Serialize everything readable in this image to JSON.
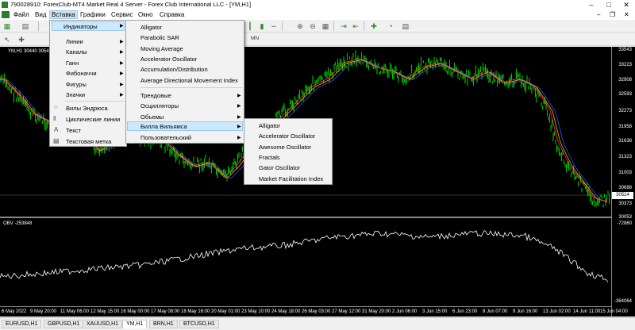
{
  "window": {
    "title": "790028910: ForexClub-MT4 Market Real 4 Server - Forex Club International LLC - [YM,H1]"
  },
  "menubar": {
    "items": [
      "Файл",
      "Вид",
      "Вставка",
      "Графики",
      "Сервис",
      "Окно",
      "Справка"
    ]
  },
  "toolbar": {
    "timeframes": [
      "MN"
    ]
  },
  "insert_menu": {
    "items": [
      "Индикаторы",
      "Линии",
      "Каналы",
      "Ганн",
      "Фибоначчи",
      "Фигуры",
      "Значки",
      "Вилы Эндрюса",
      "Циклические линии",
      "Текст",
      "Текстовая метка"
    ]
  },
  "indicators_menu": {
    "items": [
      "Alligator",
      "Parabolic SAR",
      "Moving Average",
      "Accelerator Oscillator",
      "Accumulation/Distribution",
      "Average Directional Movement Index",
      "Трендовые",
      "Осцилляторы",
      "Объемы",
      "Билла Вильямса",
      "Пользовательский"
    ]
  },
  "williams_menu": {
    "items": [
      "Alligator",
      "Accelerator Oscillator",
      "Awesome Oscillator",
      "Fractals",
      "Gator Oscillator",
      "Market Facilitation Index"
    ]
  },
  "chart": {
    "symbol_label": "YM,H1  30440 30543 30440 30524",
    "current_price": "30524",
    "price_labels": [
      "33543",
      "33223",
      "32908",
      "32593",
      "32273",
      "31958",
      "31638",
      "31323",
      "31003",
      "30688",
      "30373",
      "30053"
    ],
    "obv_label": "OBV -253848",
    "obv_scale": [
      "-72860",
      "-364064"
    ],
    "time_labels": [
      "6 May 2022",
      "9 May 20:00",
      "11 May 06:00",
      "12 May 15:00",
      "16 May 00:00",
      "17 May 08:00",
      "18 May 16:00",
      "20 May 01:00",
      "23 May 10:00",
      "24 May 18:00",
      "26 May 03:00",
      "27 May 12:00",
      "31 May 20:00",
      "2 Jun 06:00",
      "3 Jun 15:00",
      "6 Jun 23:00",
      "8 Jun 07:00",
      "9 Jun 16:00",
      "13 Jun 02:00",
      "14 Jun 11:00",
      "15 Jun 04:00"
    ]
  },
  "tabs": {
    "items": [
      "EURUSD,H1",
      "GBPUSD,H1",
      "XAUUSD,H1",
      "YM,H1",
      "BRN,H1",
      "BTCUSD,H1"
    ]
  },
  "colors": {
    "price": "#00c000",
    "ma_fast": "#ff3b3b",
    "ma_mid": "#ffb000",
    "ma_slow": "#3050ff",
    "obv": "#ffffff"
  }
}
